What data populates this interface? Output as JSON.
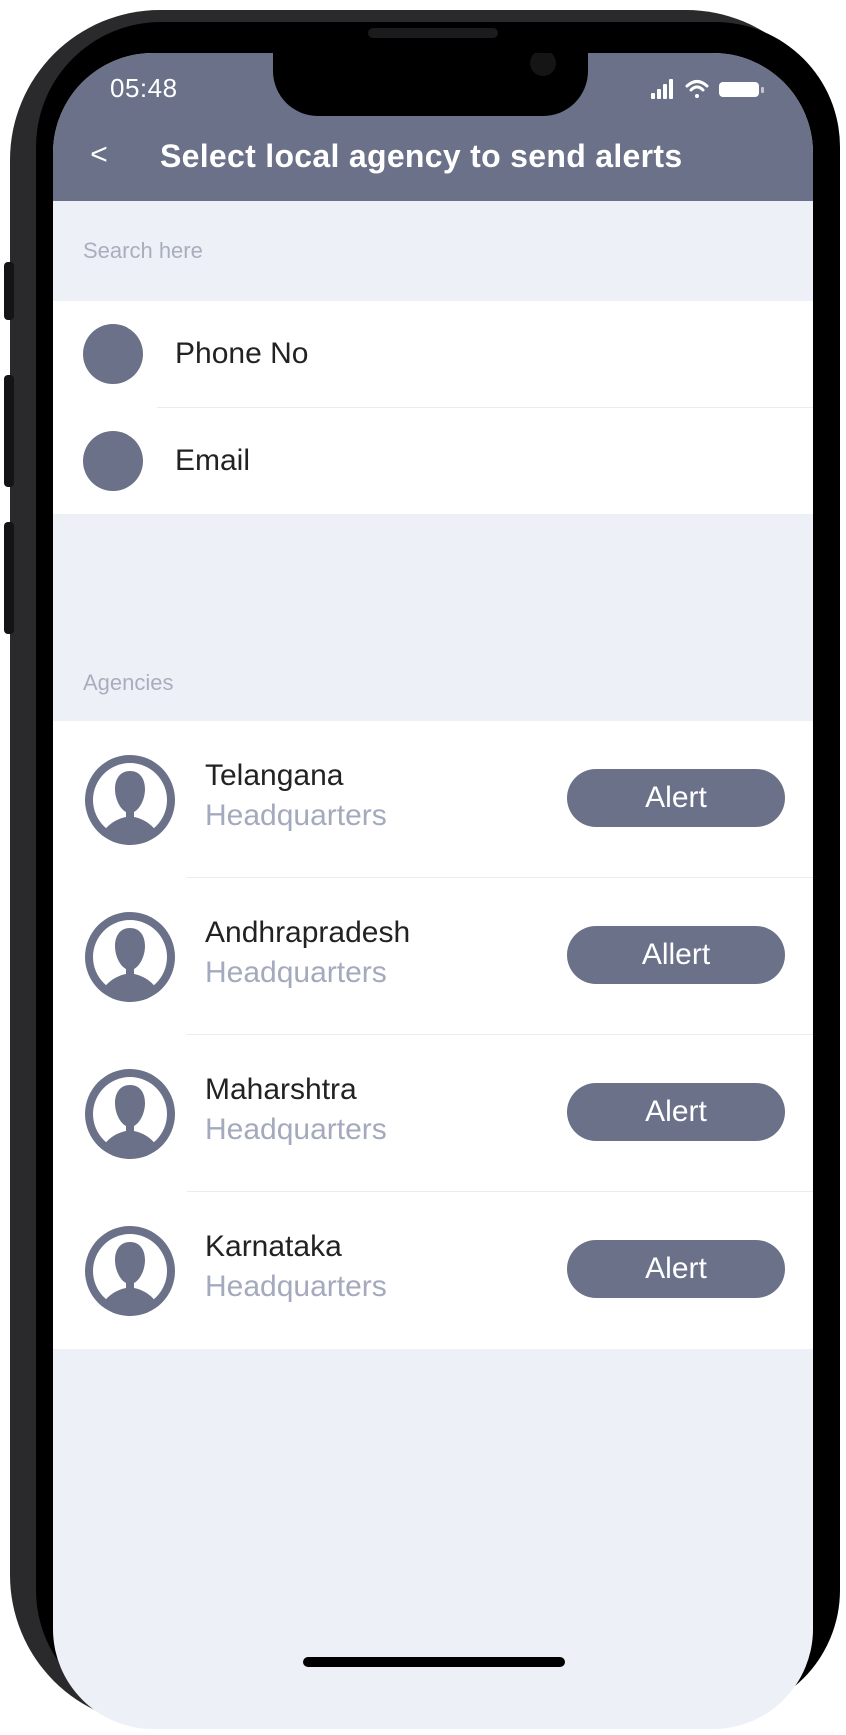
{
  "status_bar": {
    "time": "05:48",
    "icons": [
      "signal-icon",
      "wifi-icon",
      "battery-icon"
    ]
  },
  "header": {
    "back_label": "<",
    "title": "Select local agency to send alerts"
  },
  "search": {
    "placeholder": "Search here"
  },
  "options": [
    {
      "label": "Phone No"
    },
    {
      "label": "Email"
    }
  ],
  "agencies_section": {
    "label": "Agencies"
  },
  "agencies": [
    {
      "name": "Telangana",
      "subtitle": "Headquarters",
      "button_label": "Alert"
    },
    {
      "name": "Andhrapradesh",
      "subtitle": "Headquarters",
      "button_label": "Allert"
    },
    {
      "name": "Maharshtra",
      "subtitle": "Headquarters",
      "button_label": "Alert"
    },
    {
      "name": "Karnataka",
      "subtitle": "Headquarters",
      "button_label": "Alert"
    }
  ],
  "colors": {
    "primary": "#6a7188",
    "background": "#edf1f7",
    "subtitle": "#a4aabd",
    "text": "#222222"
  }
}
